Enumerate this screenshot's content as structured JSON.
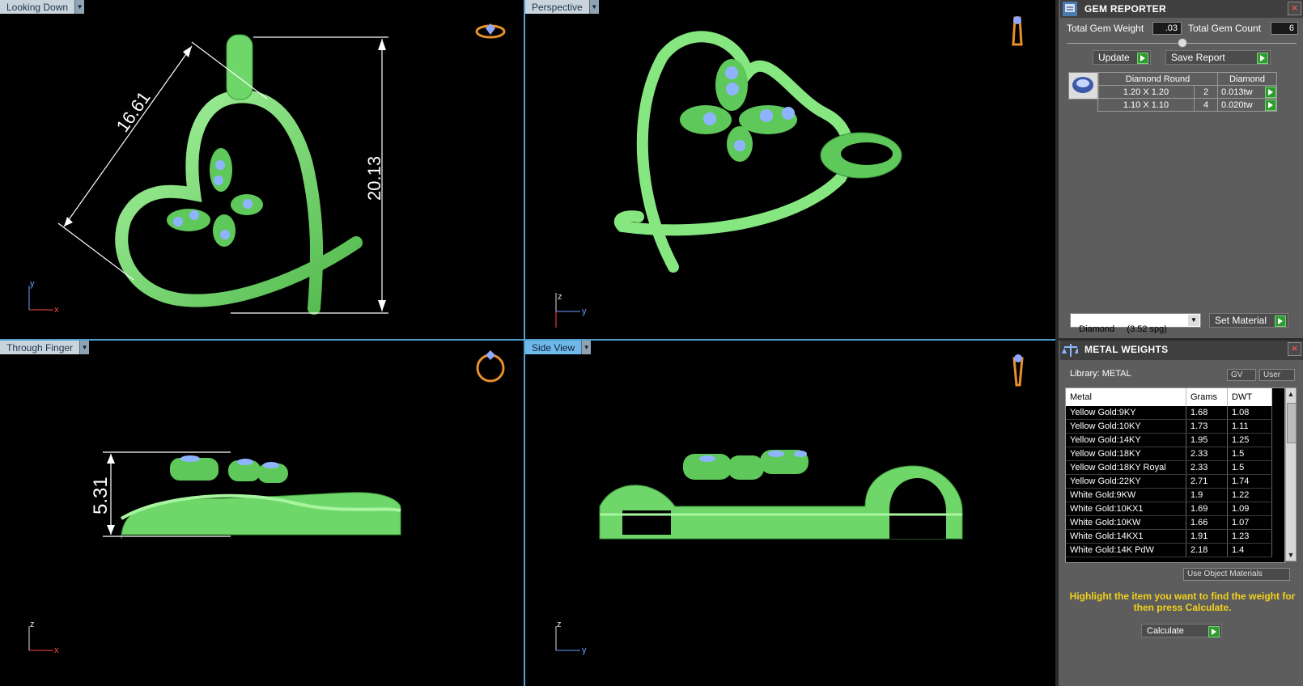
{
  "viewports": {
    "top_left": {
      "label": "Looking Down",
      "dim_diagonal": "16.61",
      "dim_height": "20.13",
      "axis_v": "y",
      "axis_h": "x"
    },
    "top_right": {
      "label": "Perspective",
      "axis_v": "z",
      "axis_h": "y"
    },
    "bottom_left": {
      "label": "Through Finger",
      "dim_height": "5.31",
      "axis_v": "z",
      "axis_h": "x"
    },
    "bottom_right": {
      "label": "Side View",
      "axis_v": "z",
      "axis_h": "y"
    }
  },
  "gem_reporter": {
    "title": "GEM REPORTER",
    "total_weight_label": "Total Gem Weight",
    "total_weight_value": ".03",
    "total_count_label": "Total Gem Count",
    "total_count_value": "6",
    "update_label": "Update",
    "save_report_label": "Save Report",
    "table_header": [
      "Diamond Round",
      "Diamond"
    ],
    "rows": [
      {
        "size": "1.20 X 1.20",
        "count": "2",
        "weight": "0.013tw"
      },
      {
        "size": "1.10 X 1.10",
        "count": "4",
        "weight": "0.020tw"
      }
    ],
    "material_select": "Diamond     (3.52 spg)",
    "set_material_label": "Set Material"
  },
  "metal_weights": {
    "title": "METAL WEIGHTS",
    "library_label": "Library: METAL",
    "gv_label": "GV",
    "user_label": "User",
    "columns": [
      "Metal",
      "Grams",
      "DWT"
    ],
    "rows": [
      [
        "Yellow Gold:9KY",
        "1.68",
        "1.08"
      ],
      [
        "Yellow Gold:10KY",
        "1.73",
        "1.11"
      ],
      [
        "Yellow Gold:14KY",
        "1.95",
        "1.25"
      ],
      [
        "Yellow Gold:18KY",
        "2.33",
        "1.5"
      ],
      [
        "Yellow Gold:18KY Royal",
        "2.33",
        "1.5"
      ],
      [
        "Yellow Gold:22KY",
        "2.71",
        "1.74"
      ],
      [
        "White Gold:9KW",
        "1.9",
        "1.22"
      ],
      [
        "White Gold:10KX1",
        "1.69",
        "1.09"
      ],
      [
        "White Gold:10KW",
        "1.66",
        "1.07"
      ],
      [
        "White Gold:14KX1",
        "1.91",
        "1.23"
      ],
      [
        "White Gold:14K PdW",
        "2.18",
        "1.4"
      ]
    ],
    "use_object_materials_label": "Use Object Materials",
    "hint": "Highlight the item you want to find the weight for then press Calculate.",
    "calculate_label": "Calculate"
  },
  "colors": {
    "model_green": "#7ee07a",
    "gem_blue": "#8fb4ff",
    "dim_white": "#ffffff",
    "hint_yellow": "#f3d21b",
    "label_active": "#6fb9ea"
  }
}
